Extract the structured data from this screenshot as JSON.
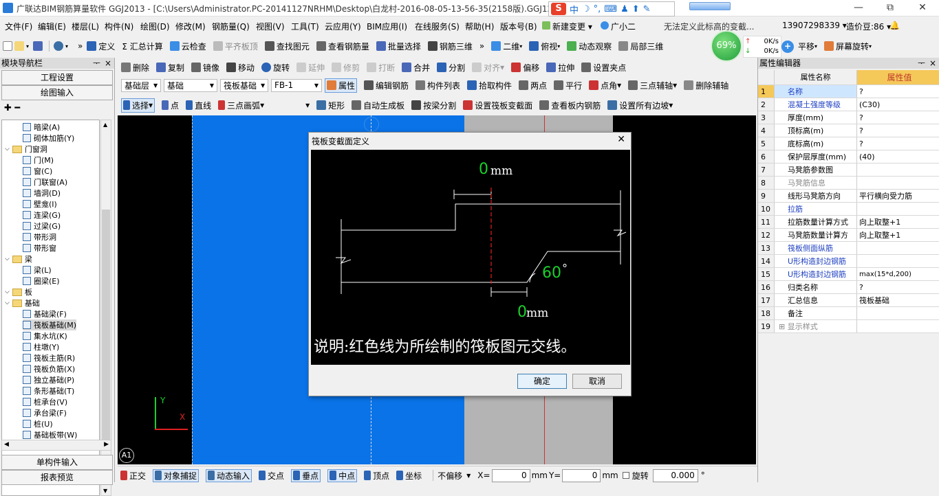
{
  "titlebar": {
    "title": "广联达BIM钢筋算量软件 GGJ2013 - [C:\\Users\\Administrator.PC-20141127NRHM\\Desktop\\白龙村-2016-08-05-13-56-35(2158版).GGJ12]",
    "minimize": "—",
    "restore": "⧉",
    "close": "✕",
    "ime_label": "S",
    "ime_zh": "中"
  },
  "menu": {
    "items": [
      "文件(F)",
      "编辑(E)",
      "楼层(L)",
      "构件(N)",
      "绘图(D)",
      "修改(M)",
      "钢筋量(Q)",
      "视图(V)",
      "工具(T)",
      "云应用(Y)",
      "BIM应用(I)",
      "在线服务(S)",
      "帮助(H)",
      "版本号(B)",
      "新建变更",
      "广小二"
    ],
    "notice": "无法定义此标高的变截...",
    "phone": "13907298339",
    "cost": "造价豆:86"
  },
  "toolbar1": {
    "items": [
      "定义",
      "Σ 汇总计算",
      "云检查",
      "平齐板顶",
      "查找图元",
      "查看钢筋量",
      "批量选择",
      "钢筋三维",
      "二维",
      "俯视",
      "动态观察",
      "局部三维",
      "平移",
      "屏幕旋转"
    ],
    "speed_pct": "69%",
    "net_up": "0K/s",
    "net_down": "0K/s"
  },
  "toolbar2": {
    "items": [
      "删除",
      "复制",
      "镜像",
      "移动",
      "旋转",
      "延伸",
      "修剪",
      "打断",
      "合并",
      "分割",
      "对齐",
      "偏移",
      "拉伸",
      "设置夹点"
    ]
  },
  "toolbar3": {
    "dropdowns": [
      "基础层",
      "基础",
      "筏板基础",
      "FB-1"
    ],
    "items": [
      "属性",
      "编辑钢筋",
      "构件列表",
      "拾取构件",
      "两点",
      "平行",
      "点角",
      "三点辅轴",
      "删除辅轴"
    ]
  },
  "toolbar4": {
    "items": [
      "选择",
      "点",
      "直线",
      "三点画弧",
      "矩形",
      "自动生成板",
      "按梁分割",
      "设置筏板变截面",
      "查看板内钢筋",
      "设置所有边坡"
    ]
  },
  "leftpanel": {
    "title": "模块导航栏",
    "pin": "ᅮ",
    "close": "×",
    "btn_project": "工程设置",
    "btn_draw": "绘图输入",
    "btn_single": "单构件输入",
    "btn_report": "报表预览",
    "tree": [
      {
        "label": "暗梁(A)",
        "indent": 2
      },
      {
        "label": "砌体加筋(Y)",
        "indent": 2
      },
      {
        "label": "门窗洞",
        "indent": 1,
        "folder": true
      },
      {
        "label": "门(M)",
        "indent": 2
      },
      {
        "label": "窗(C)",
        "indent": 2
      },
      {
        "label": "门联窗(A)",
        "indent": 2
      },
      {
        "label": "墙洞(D)",
        "indent": 2
      },
      {
        "label": "壁龛(I)",
        "indent": 2
      },
      {
        "label": "连梁(G)",
        "indent": 2
      },
      {
        "label": "过梁(G)",
        "indent": 2
      },
      {
        "label": "带形洞",
        "indent": 2
      },
      {
        "label": "带形窗",
        "indent": 2
      },
      {
        "label": "梁",
        "indent": 1,
        "folder": true
      },
      {
        "label": "梁(L)",
        "indent": 2
      },
      {
        "label": "圈梁(E)",
        "indent": 2
      },
      {
        "label": "板",
        "indent": 1,
        "folder": true
      },
      {
        "label": "基础",
        "indent": 1,
        "folder": true
      },
      {
        "label": "基础梁(F)",
        "indent": 2
      },
      {
        "label": "筏板基础(M)",
        "indent": 2,
        "selected": true
      },
      {
        "label": "集水坑(K)",
        "indent": 2
      },
      {
        "label": "柱墩(Y)",
        "indent": 2
      },
      {
        "label": "筏板主筋(R)",
        "indent": 2
      },
      {
        "label": "筏板负筋(X)",
        "indent": 2
      },
      {
        "label": "独立基础(P)",
        "indent": 2
      },
      {
        "label": "条形基础(T)",
        "indent": 2
      },
      {
        "label": "桩承台(V)",
        "indent": 2
      },
      {
        "label": "承台梁(F)",
        "indent": 2
      },
      {
        "label": "桩(U)",
        "indent": 2
      },
      {
        "label": "基础板带(W)",
        "indent": 2
      }
    ]
  },
  "canvas": {
    "axis_label": "A1",
    "y_label": "Y",
    "x_label": "X"
  },
  "dialog": {
    "title": "筏板变截面定义",
    "dim_top": "0",
    "dim_unit": "mm",
    "dim_bottom": "0",
    "angle": "60",
    "angle_unit": "°",
    "note": "说明:红色线为所绘制的筏板图元交线。",
    "ok": "确定",
    "cancel": "取消",
    "close": "✕"
  },
  "propanel": {
    "title": "属性编辑器",
    "col_name": "属性名称",
    "col_value": "属性值",
    "rows": [
      {
        "n": "1",
        "k": "名称",
        "v": "?",
        "style": "blue",
        "sel": true
      },
      {
        "n": "2",
        "k": "混凝土强度等级",
        "v": "(C30)",
        "style": "blue"
      },
      {
        "n": "3",
        "k": "厚度(mm)",
        "v": "?"
      },
      {
        "n": "4",
        "k": "顶标高(m)",
        "v": "?"
      },
      {
        "n": "5",
        "k": "底标高(m)",
        "v": "?"
      },
      {
        "n": "6",
        "k": "保护层厚度(mm)",
        "v": "(40)"
      },
      {
        "n": "7",
        "k": "马凳筋参数图",
        "v": ""
      },
      {
        "n": "8",
        "k": "马凳筋信息",
        "v": "",
        "style": "gray"
      },
      {
        "n": "9",
        "k": "线形马凳筋方向",
        "v": "平行横向受力筋"
      },
      {
        "n": "10",
        "k": "拉筋",
        "v": "",
        "style": "blue"
      },
      {
        "n": "11",
        "k": "拉筋数量计算方式",
        "v": "向上取整+1"
      },
      {
        "n": "12",
        "k": "马凳筋数量计算方",
        "v": "向上取整+1"
      },
      {
        "n": "13",
        "k": "筏板侧面纵筋",
        "v": "",
        "style": "blue"
      },
      {
        "n": "14",
        "k": "U形构造封边钢筋",
        "v": "",
        "style": "blue"
      },
      {
        "n": "15",
        "k": "U形构造封边钢筋",
        "v": "max(15*d,200)",
        "style": "blue"
      },
      {
        "n": "16",
        "k": "归类名称",
        "v": "?"
      },
      {
        "n": "17",
        "k": "汇总信息",
        "v": "筏板基础"
      },
      {
        "n": "18",
        "k": "备注",
        "v": ""
      },
      {
        "n": "19",
        "k": "⊞ 显示样式",
        "v": "",
        "style": "gray"
      }
    ]
  },
  "statusbar": {
    "items": [
      "正交",
      "对象捕捉",
      "动态输入",
      "交点",
      "垂点",
      "中点",
      "顶点",
      "坐标"
    ],
    "offset": "不偏移",
    "x_label": "X=",
    "x_val": "0",
    "unit": "mm",
    "y_label": "Y=",
    "y_val": "0",
    "rotate": "旋转",
    "rotate_val": "0.000",
    "deg": "°"
  }
}
